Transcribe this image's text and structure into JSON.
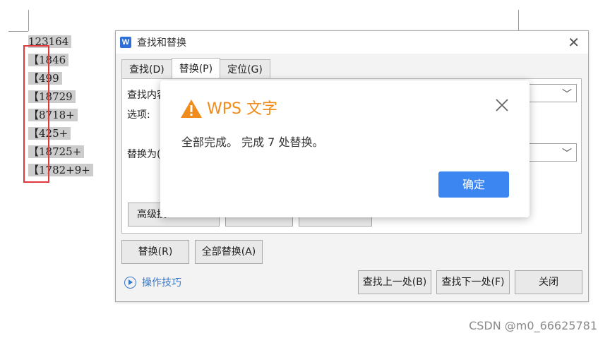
{
  "document": {
    "lines": [
      {
        "text": "123164",
        "selected": true
      },
      {
        "text": "【1846",
        "selected": true
      },
      {
        "text": "【499",
        "selected": true
      },
      {
        "text": "【18729",
        "selected": true
      },
      {
        "text": "【8718+",
        "selected": true
      },
      {
        "text": "【425+",
        "selected": true
      },
      {
        "text": "【18725+",
        "selected": true
      },
      {
        "text": "【1782+9+",
        "selected": true
      }
    ],
    "highlight_color": "#e0393e"
  },
  "find_replace": {
    "logo": "W",
    "title": "查找和替换",
    "tabs": [
      {
        "label": "查找(D)",
        "active": false
      },
      {
        "label": "替换(P)",
        "active": true
      },
      {
        "label": "定位(G)",
        "active": false
      }
    ],
    "find_label": "查找内容",
    "options_label": "选项:",
    "replace_label": "替换为(",
    "advanced_label": "高级搜",
    "replace_button": "替换(R)",
    "replace_all_button": "全部替换(A)",
    "tips_link": "操作技巧",
    "find_prev_button": "查找上一处(B)",
    "find_next_button": "查找下一处(F)",
    "close_button": "关闭"
  },
  "message_box": {
    "title": "WPS 文字",
    "message": "全部完成。 完成 7 处替换。",
    "ok_button": "确定",
    "accent_color": "#f08c1c",
    "button_color": "#3b86f0"
  },
  "watermark": "CSDN @m0_66625781"
}
